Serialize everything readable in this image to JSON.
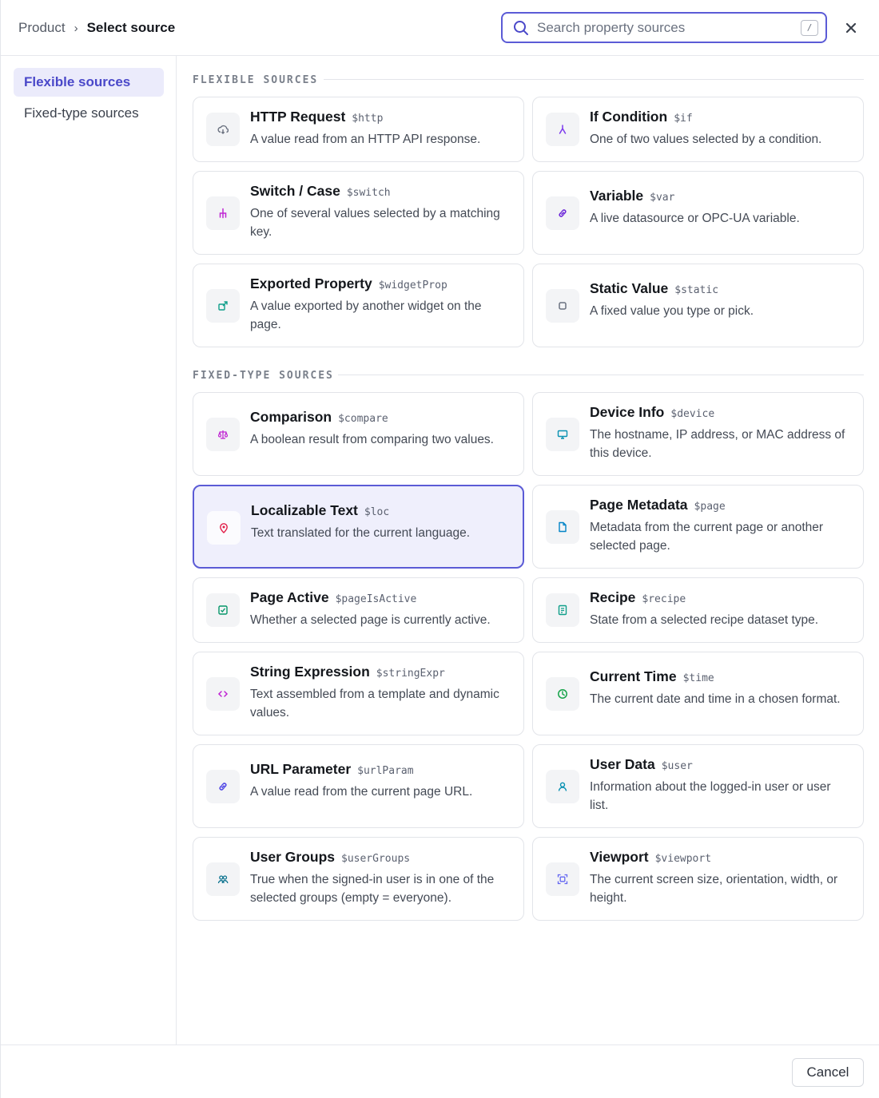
{
  "breadcrumb": {
    "root": "Product",
    "separator": "›",
    "current": "Select source"
  },
  "search": {
    "placeholder": "Search property sources",
    "value": "",
    "shortcut": "/"
  },
  "close": {
    "label": "×",
    "icon": "close-icon"
  },
  "sidebar": {
    "items": [
      {
        "label": "Flexible sources",
        "active": true
      },
      {
        "label": "Fixed-type sources",
        "active": false
      }
    ]
  },
  "sections": {
    "flexible": {
      "title": "FLEXIBLE SOURCES",
      "cards": [
        {
          "title": "HTTP Request",
          "token": "$http",
          "desc": "A value read from an HTTP API response.",
          "icon": "cloud-download-icon",
          "icon_color": "#6b7280"
        },
        {
          "title": "If Condition",
          "token": "$if",
          "desc": "One of two values selected by a condition.",
          "icon": "branch-icon",
          "icon_color": "#7c3aed"
        },
        {
          "title": "Switch / Case",
          "token": "$switch",
          "desc": "One of several values selected by a matching key.",
          "icon": "fork-icon",
          "icon_color": "#c026d3"
        },
        {
          "title": "Variable",
          "token": "$var",
          "desc": "A live datasource or OPC-UA variable.",
          "icon": "link-icon",
          "icon_color": "#6d28d9"
        },
        {
          "title": "Exported Property",
          "token": "$widgetProp",
          "desc": "A value exported by another widget on the page.",
          "icon": "export-icon",
          "icon_color": "#0f9f8a"
        },
        {
          "title": "Static Value",
          "token": "$static",
          "desc": "A fixed value you type or pick.",
          "icon": "square-icon",
          "icon_color": "#6b7280"
        }
      ]
    },
    "fixed": {
      "title": "FIXED-TYPE SOURCES",
      "cards": [
        {
          "title": "Comparison",
          "token": "$compare",
          "desc": "A boolean result from comparing two values.",
          "icon": "scale-icon",
          "icon_color": "#c026d3"
        },
        {
          "title": "Device Info",
          "token": "$device",
          "desc": "The hostname, IP address, or MAC address of this device.",
          "icon": "monitor-icon",
          "icon_color": "#0891b2"
        },
        {
          "title": "Localizable Text",
          "token": "$loc",
          "desc": "Text translated for the current language.",
          "icon": "location-pin-icon",
          "icon_color": "#e11d48",
          "selected": true
        },
        {
          "title": "Page Metadata",
          "token": "$page",
          "desc": "Metadata from the current page or another selected page.",
          "icon": "document-icon",
          "icon_color": "#0284c7"
        },
        {
          "title": "Page Active",
          "token": "$pageIsActive",
          "desc": "Whether a selected page is currently active.",
          "icon": "check-square-icon",
          "icon_color": "#059669"
        },
        {
          "title": "Recipe",
          "token": "$recipe",
          "desc": "State from a selected recipe dataset type.",
          "icon": "recipe-icon",
          "icon_color": "#0f9f8a"
        },
        {
          "title": "String Expression",
          "token": "$stringExpr",
          "desc": "Text assembled from a template and dynamic values.",
          "icon": "code-icon",
          "icon_color": "#c026d3"
        },
        {
          "title": "Current Time",
          "token": "$time",
          "desc": "The current date and time in a chosen format.",
          "icon": "clock-icon",
          "icon_color": "#16a34a"
        },
        {
          "title": "URL Parameter",
          "token": "$urlParam",
          "desc": "A value read from the current page URL.",
          "icon": "link-icon",
          "icon_color": "#4f46e5"
        },
        {
          "title": "User Data",
          "token": "$user",
          "desc": "Information about the logged-in user or user list.",
          "icon": "user-icon",
          "icon_color": "#0891b2"
        },
        {
          "title": "User Groups",
          "token": "$userGroups",
          "desc": "True when the signed-in user is in one of the selected groups (empty = everyone).",
          "icon": "users-icon",
          "icon_color": "#0e7490"
        },
        {
          "title": "Viewport",
          "token": "$viewport",
          "desc": "The current screen size, orientation, width, or height.",
          "icon": "viewport-icon",
          "icon_color": "#6366f1"
        }
      ]
    }
  },
  "footer": {
    "cancel_label": "Cancel"
  },
  "colors": {
    "accent": "#5b5bd6",
    "selected_bg": "#efeffc",
    "active_nav_bg": "#ebebfb"
  }
}
